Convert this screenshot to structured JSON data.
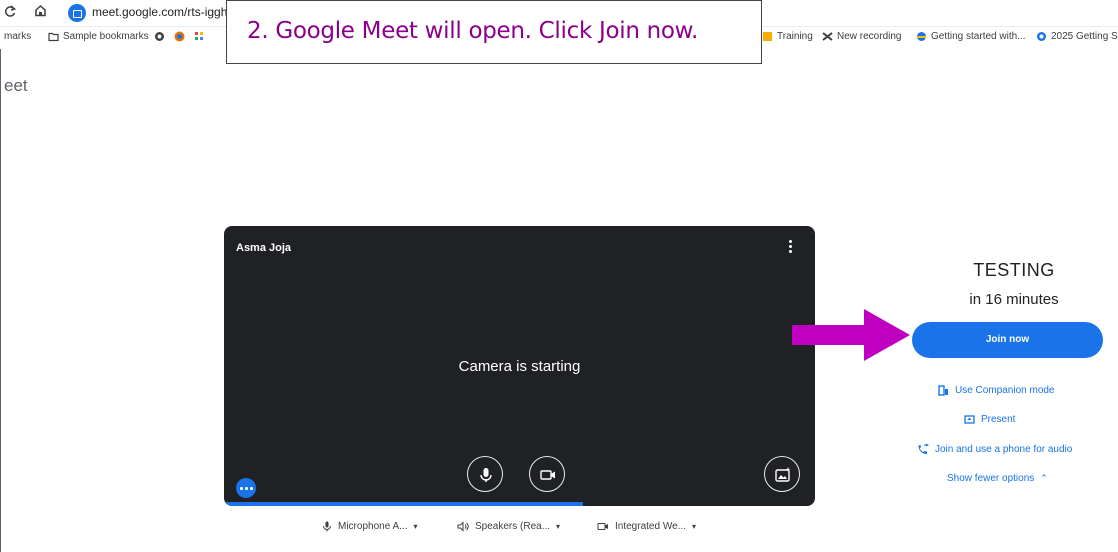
{
  "browser": {
    "url": "meet.google.com/rts-iggh-",
    "bookmarks": {
      "left_1": "marks",
      "left_2": "Sample bookmarks",
      "right_1": "Training",
      "right_2": "New recording",
      "right_3": "Getting started with...",
      "right_4": "2025 Getting S"
    }
  },
  "app": {
    "title": "eet"
  },
  "callout": {
    "text": "2. Google Meet will open.  Click Join now."
  },
  "preview": {
    "user_name": "Asma Joja",
    "status": "Camera is starting"
  },
  "meeting": {
    "title": "TESTING",
    "when": "in 16 minutes",
    "join_label": "Join now",
    "companion_label": "Use Companion mode",
    "present_label": "Present",
    "phone_label": "Join and use a phone for audio",
    "fewer_label": "Show fewer options"
  },
  "devices": {
    "microphone": "Microphone A...",
    "speakers": "Speakers (Rea...",
    "camera": "Integrated We..."
  },
  "colors": {
    "accent": "#1a73e8",
    "callout_text": "#8b008b",
    "arrow": "#c000c0",
    "preview_bg": "#202124"
  },
  "icons": [
    "reload-icon",
    "home-icon",
    "meet-icon",
    "folder-icon",
    "more-vert-icon",
    "mic-icon",
    "camera-icon",
    "effects-icon",
    "companion-icon",
    "present-icon",
    "phone-icon",
    "chevron-up-icon",
    "dropdown-icon"
  ]
}
